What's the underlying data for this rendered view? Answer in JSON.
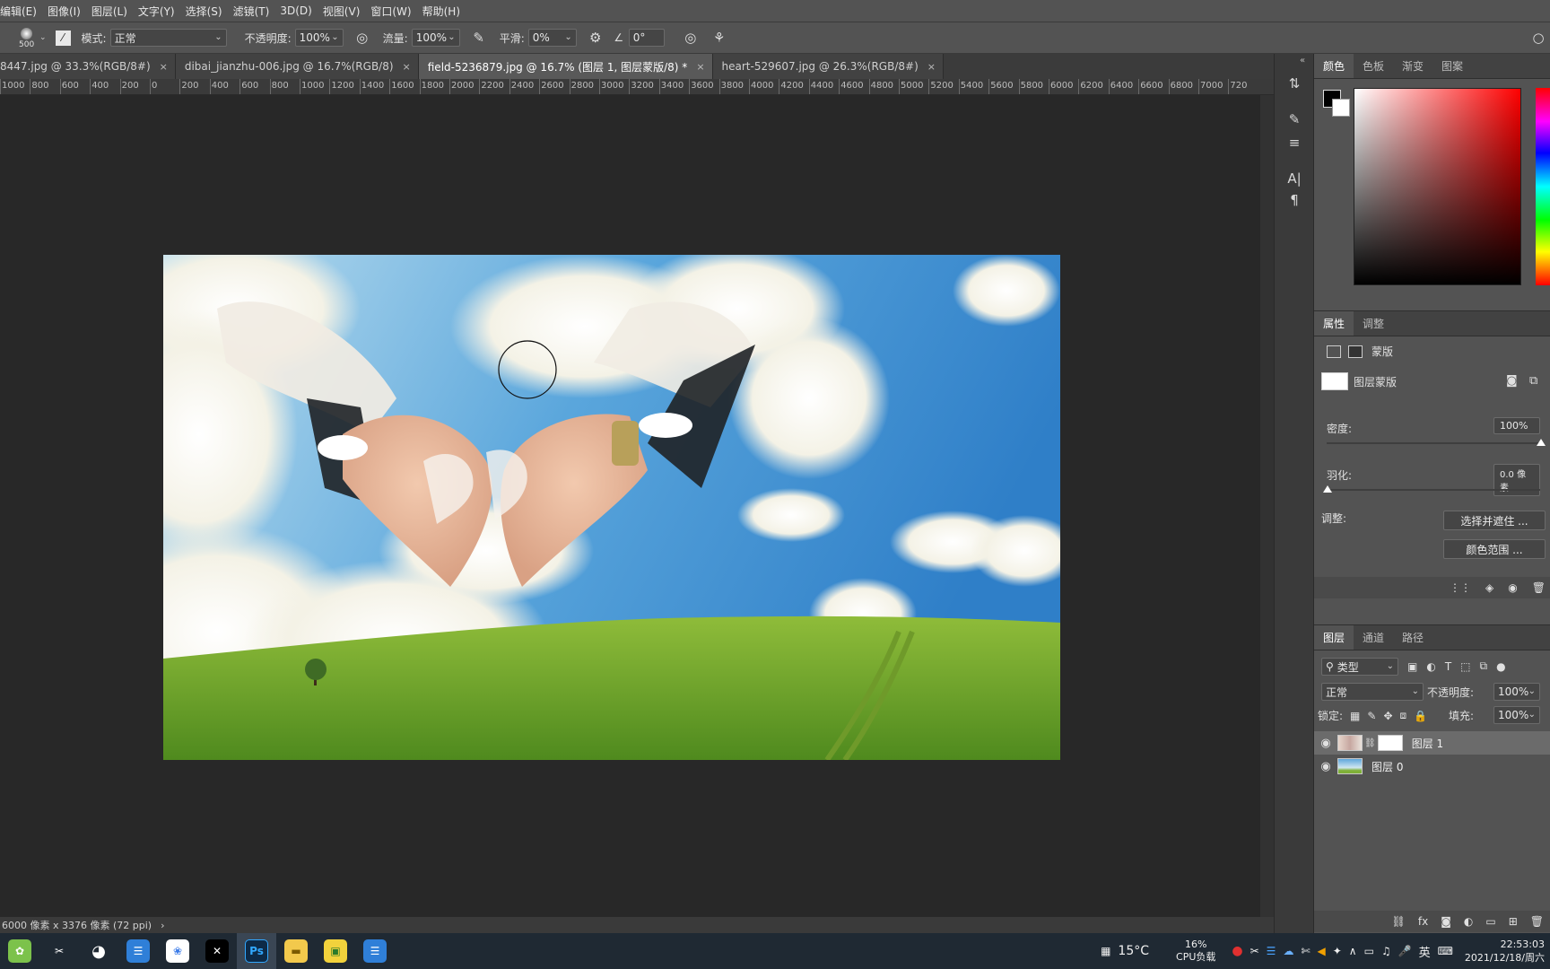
{
  "menu": [
    "编辑(E)",
    "图像(I)",
    "图层(L)",
    "文字(Y)",
    "选择(S)",
    "滤镜(T)",
    "3D(D)",
    "视图(V)",
    "窗口(W)",
    "帮助(H)"
  ],
  "options": {
    "brush_size": "500",
    "mode_label": "模式:",
    "mode_value": "正常",
    "opacity_label": "不透明度:",
    "opacity_value": "100%",
    "flow_label": "流量:",
    "flow_value": "100%",
    "smooth_label": "平滑:",
    "smooth_value": "0%",
    "angle_value": "0°"
  },
  "tabs": [
    {
      "label": "8447.jpg @ 33.3%(RGB/8#)",
      "active": false
    },
    {
      "label": "dibai_jianzhu-006.jpg @ 16.7%(RGB/8)",
      "active": false
    },
    {
      "label": "field-5236879.jpg @ 16.7% (图层 1, 图层蒙版/8) *",
      "active": true
    },
    {
      "label": "heart-529607.jpg @ 26.3%(RGB/8#)",
      "active": false
    }
  ],
  "ruler_ticks": [
    "1000",
    "800",
    "600",
    "400",
    "200",
    "0",
    "200",
    "400",
    "600",
    "800",
    "1000",
    "1200",
    "1400",
    "1600",
    "1800",
    "2000",
    "2200",
    "2400",
    "2600",
    "2800",
    "3000",
    "3200",
    "3400",
    "3600",
    "3800",
    "4000",
    "4200",
    "4400",
    "4600",
    "4800",
    "5000",
    "5200",
    "5400",
    "5600",
    "5800",
    "6000",
    "6200",
    "6400",
    "6600",
    "6800",
    "7000",
    "720"
  ],
  "status": {
    "doc_size": "6000 像素 x 3376 像素 (72 ppi)",
    "arrow": "›"
  },
  "color_panel": {
    "tabs": [
      "颜色",
      "色板",
      "渐变",
      "图案"
    ],
    "fg_color": "#000000",
    "bg_color": "#ffffff"
  },
  "properties": {
    "tabs": [
      "属性",
      "调整"
    ],
    "mask_type": "蒙版",
    "layer_mask": "图层蒙版",
    "density_label": "密度:",
    "density_value": "100%",
    "feather_label": "羽化:",
    "feather_value": "0.0 像素",
    "adjust_label": "调整:",
    "select_mask_btn": "选择并遮住 ...",
    "color_range_btn": "颜色范围 ..."
  },
  "layers_panel": {
    "tabs": [
      "图层",
      "通道",
      "路径"
    ],
    "filter_kind": "类型",
    "blend_mode": "正常",
    "opacity_label": "不透明度:",
    "opacity_value": "100%",
    "lock_label": "锁定:",
    "fill_label": "填充:",
    "fill_value": "100%",
    "layers": [
      {
        "name": "图层 1",
        "selected": true
      },
      {
        "name": "图层 0",
        "selected": false
      }
    ]
  },
  "taskbar": {
    "temperature": "15°C",
    "cpu_percent": "16%",
    "cpu_label": "CPU负载",
    "ime": "英",
    "time": "22:53:03",
    "date": "2021/12/18/周六"
  }
}
